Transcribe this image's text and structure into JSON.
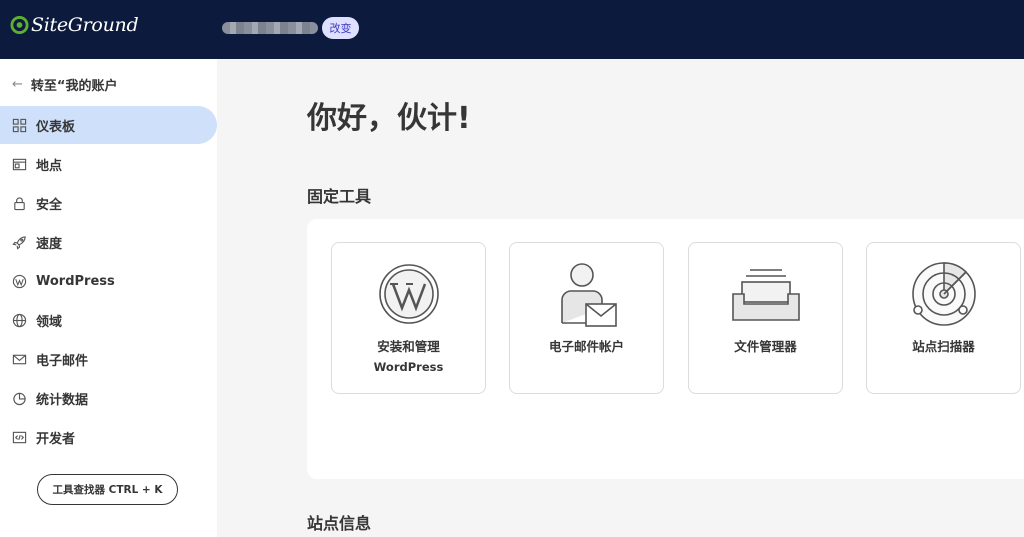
{
  "topbar": {
    "logo_text": "SiteGround",
    "change_label": "改变"
  },
  "sidebar": {
    "back_label": "转至“我的账户",
    "items": [
      {
        "label": "仪表板",
        "icon": "dashboard-grid-icon",
        "active": true
      },
      {
        "label": "地点",
        "icon": "site-window-icon"
      },
      {
        "label": "安全",
        "icon": "lock-icon"
      },
      {
        "label": "速度",
        "icon": "rocket-icon"
      },
      {
        "label": "WordPress",
        "icon": "wordpress-icon"
      },
      {
        "label": "领域",
        "icon": "globe-icon"
      },
      {
        "label": "电子邮件",
        "icon": "envelope-icon"
      },
      {
        "label": "统计数据",
        "icon": "pie-chart-icon"
      },
      {
        "label": "开发者",
        "icon": "code-icon"
      }
    ],
    "finder_label": "工具查找器 CTRL + K"
  },
  "main": {
    "greeting": "你好，伙计!",
    "pinned_title": "固定工具",
    "tools": [
      {
        "line1": "安装和管理",
        "line2": "WordPress",
        "icon": "wordpress-large-icon"
      },
      {
        "line1": "电子邮件帐户",
        "line2": "",
        "icon": "email-user-icon"
      },
      {
        "line1": "文件管理器",
        "line2": "",
        "icon": "file-tray-icon"
      },
      {
        "line1": "站点扫描器",
        "line2": "",
        "icon": "radar-scanner-icon"
      }
    ],
    "site_info_title": "站点信息"
  },
  "colors": {
    "topbar": "#0c1a3d",
    "active_nav": "#cfe0fb",
    "logo_green": "#5db031",
    "badge_bg": "#dfe0ff"
  }
}
